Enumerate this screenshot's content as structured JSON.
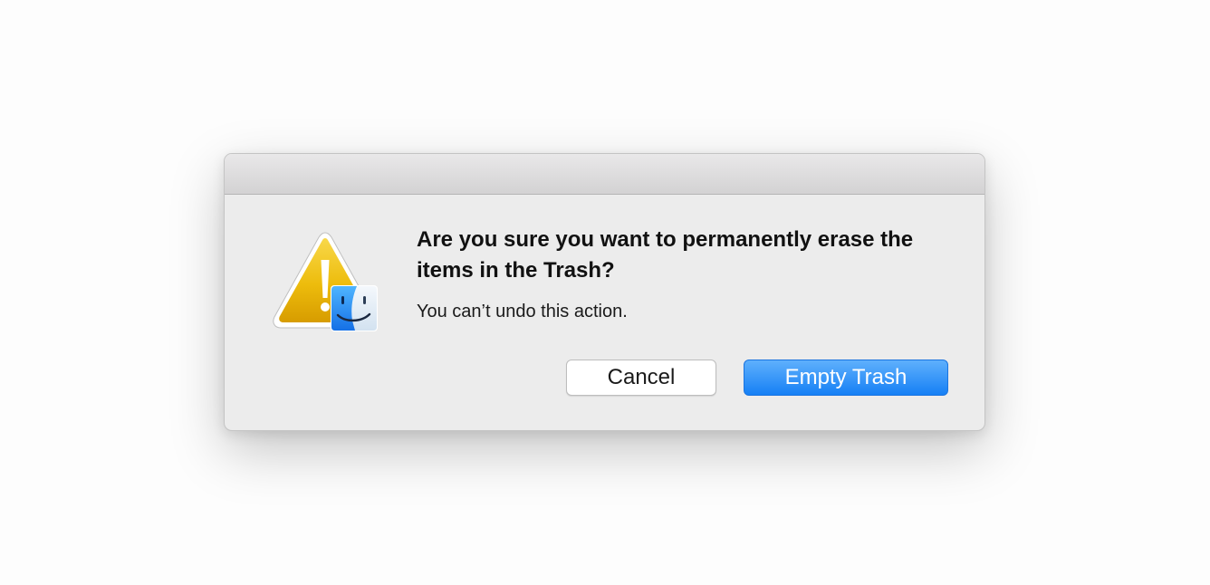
{
  "dialog": {
    "heading": "Are you sure you want to permanently erase the items in the Trash?",
    "message": "You can’t undo this action.",
    "icons": {
      "main": "warning-triangle-icon",
      "badge": "finder-icon"
    },
    "buttons": {
      "cancel_label": "Cancel",
      "confirm_label": "Empty Trash"
    }
  },
  "colors": {
    "primary_button": "#1a80f5",
    "warning_yellow": "#f2c500",
    "dialog_background": "#ececec"
  }
}
